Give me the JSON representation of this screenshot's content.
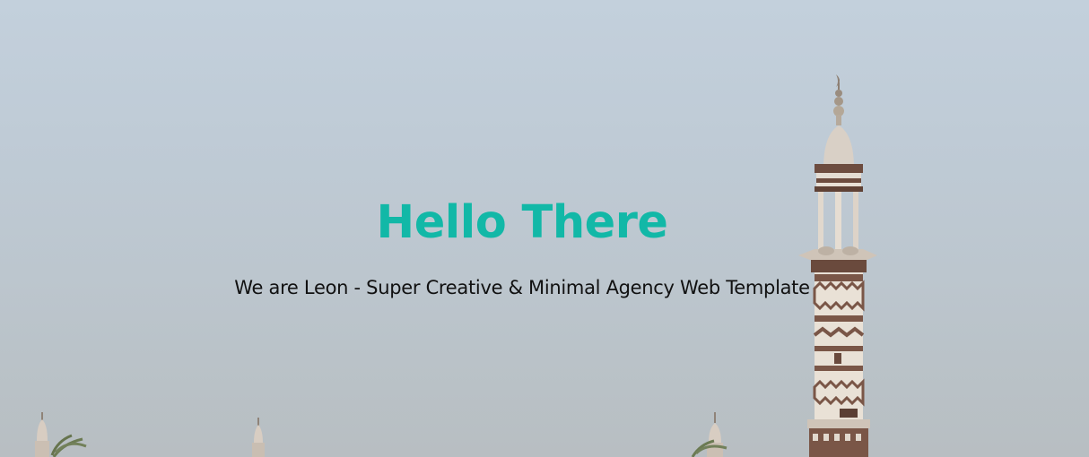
{
  "hero": {
    "title": "Hello There",
    "subtitle": "We are Leon - Super Creative & Minimal Agency Web Template",
    "title_color": "#12b8a7",
    "subtitle_color": "#111111",
    "background_image": "minaret-icon"
  }
}
